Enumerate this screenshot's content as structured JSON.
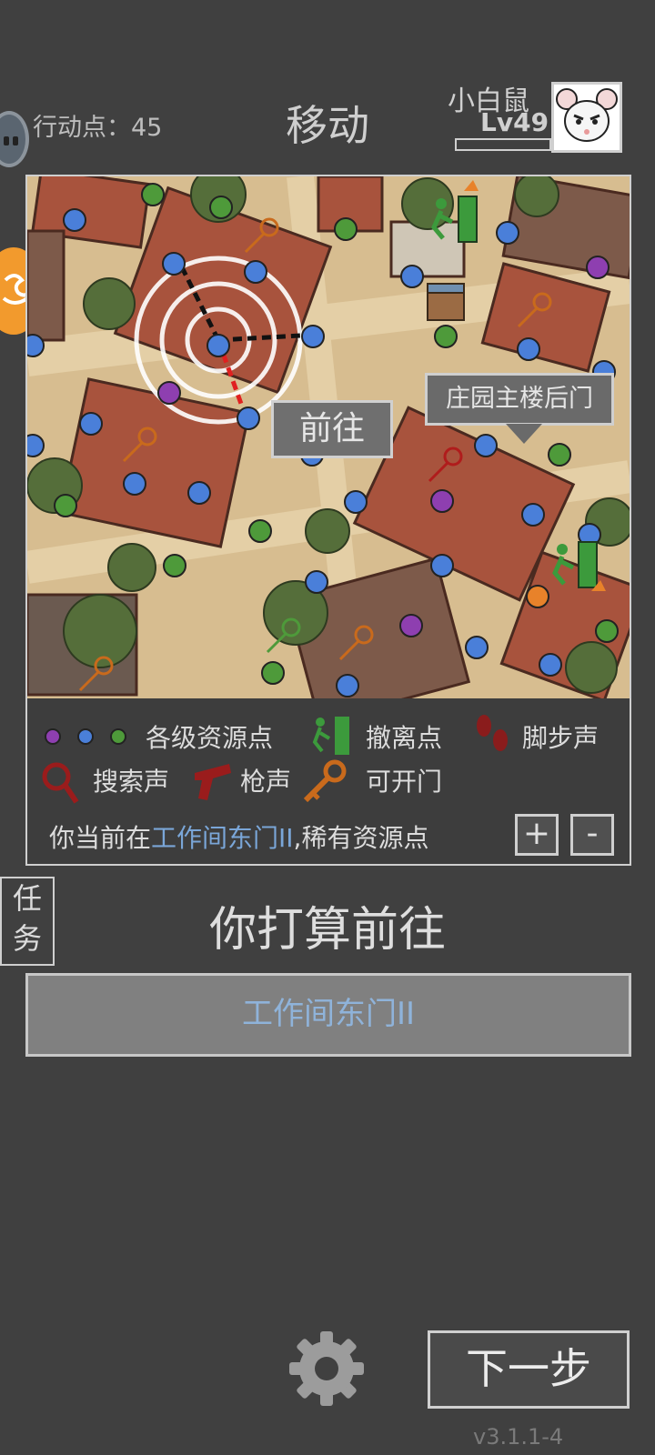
{
  "header": {
    "action_points_label": "行动点：45",
    "title": "移动",
    "player_name": "小白鼠",
    "player_level": "Lv49"
  },
  "map": {
    "goto_label": "前往",
    "tooltip_location": "庄园主楼后门",
    "resource_colors": {
      "purple": "#8e3fb0",
      "blue": "#4a7fd9",
      "green": "#4e9a3a",
      "orange": "#e8822a"
    }
  },
  "legend": {
    "resources_label": "各级资源点",
    "extract_label": "撤离点",
    "footsteps_label": "脚步声",
    "search_label": "搜索声",
    "gunshot_label": "枪声",
    "door_label": "可开门",
    "location_prefix": "你当前在",
    "location_name": "工作间东门II",
    "location_suffix": ",稀有资源点",
    "zoom_in_label": "+",
    "zoom_out_label": "-"
  },
  "task_tab_label": "任\n务",
  "task_tab_chars": [
    "任",
    "务"
  ],
  "prompt": "你打算前往",
  "destination_button": "工作间东门II",
  "next_button": "下一步",
  "version": "v3.1.1-4",
  "icons": [
    "chat-icon",
    "sidebar-fab-icon",
    "extract-icon",
    "key-icon",
    "gunshot-icon",
    "search-icon",
    "footsteps-icon",
    "settings-gear-icon",
    "supply-crate-icon"
  ]
}
